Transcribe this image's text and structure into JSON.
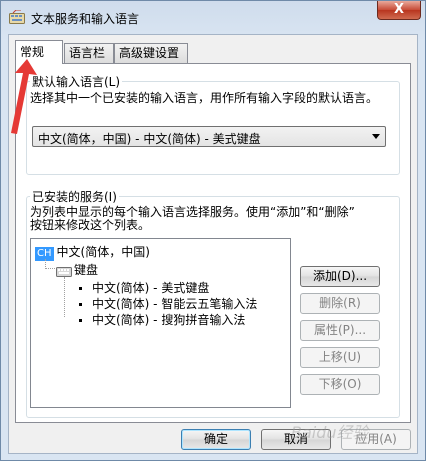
{
  "window": {
    "title": "文本服务和输入语言",
    "close_glyph": "X"
  },
  "tabs": [
    {
      "label": "常规"
    },
    {
      "label": "语言栏"
    },
    {
      "label": "高级键设置"
    }
  ],
  "default_language": {
    "label": "默认输入语言(L)",
    "description": "选择其中一个已安装的输入语言，用作所有输入字段的默认语言。",
    "selected": "中文(简体，中国) - 中文(简体) - 美式键盘"
  },
  "installed_services": {
    "label": "已安装的服务(I)",
    "description_line1": "为列表中显示的每个输入语言选择服务。使用“添加”和“删除”",
    "description_line2": "按钮来修改这个列表。",
    "language_badge": "CH",
    "language": "中文(简体，中国)",
    "category": "键盘",
    "services": [
      "中文(简体) - 美式键盘",
      "中文(简体) - 智能云五笔输入法",
      "中文(简体) - 搜狗拼音输入法"
    ]
  },
  "side_buttons": {
    "add": "添加(D)...",
    "remove": "删除(R)",
    "properties": "属性(P)...",
    "move_up": "上移(U)",
    "move_down": "下移(O)"
  },
  "footer": {
    "ok": "确定",
    "cancel": "取消",
    "apply": "应用(A)"
  },
  "watermark": "Baidu经验",
  "colors": {
    "accent": "#3399ff",
    "annotation_arrow": "#e53935"
  }
}
